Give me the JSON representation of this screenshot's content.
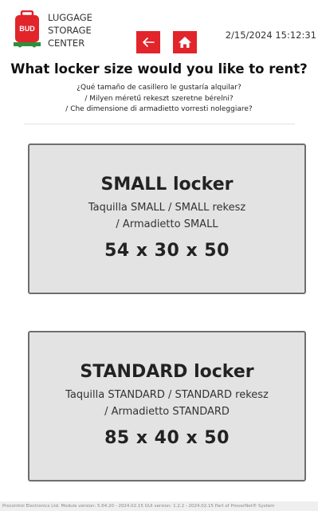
{
  "header": {
    "brand_badge": "BUD",
    "brand_line1": "LUGGAGE",
    "brand_line2": "STORAGE",
    "brand_line3": "CENTER",
    "datetime": "2/15/2024 15:12:31",
    "brand_color": "#e1252b",
    "icons": {
      "back": "arrow-left-icon",
      "home": "home-icon"
    }
  },
  "question": {
    "title": "What locker size would you like to rent?",
    "es": "¿Qué tamaño de casillero le gustaría alquilar?",
    "hu": "/ Milyen méretű rekeszt szeretne bérelni?",
    "it": "/ Che dimensione di armadietto vorresti noleggiare?"
  },
  "lockers": [
    {
      "name": "SMALL locker",
      "alt_line1": "Taquilla SMALL / SMALL rekesz",
      "alt_line2": "/ Armadietto SMALL",
      "dimensions": "54 x 30 x 50"
    },
    {
      "name": "STANDARD locker",
      "alt_line1": "Taquilla STANDARD / STANDARD rekesz",
      "alt_line2": "/ Armadietto STANDARD",
      "dimensions": "85 x 40 x 50"
    }
  ],
  "footer": {
    "text": "Procontrol Electronics Ltd. Module version: 5.64.20 - 2024.02.15 GUI version: 1.2.2 - 2024.02.15 Part of ProverNet® System"
  }
}
